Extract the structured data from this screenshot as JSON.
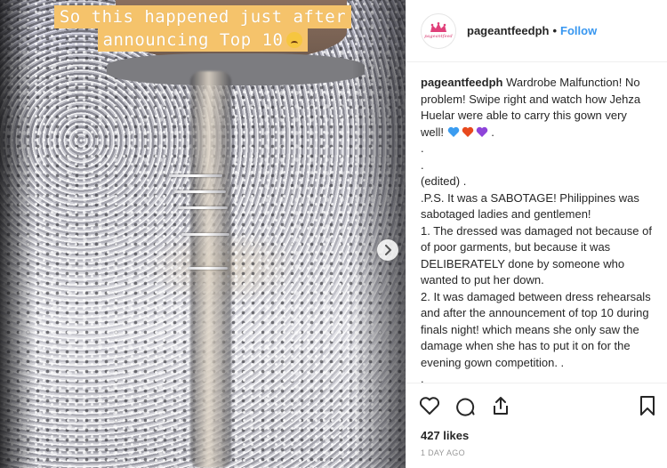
{
  "photo": {
    "overlay_lines": [
      "So this happened just after",
      "announcing Top 10"
    ]
  },
  "header": {
    "avatar_logo_text": "pageantfeed",
    "username": "pageantfeedph",
    "separator": "•",
    "follow_label": "Follow"
  },
  "caption": {
    "username": "pageantfeedph",
    "lines": [
      "Wardrobe Malfunction! No problem! Swipe right and watch how Jehza Huelar were able to carry this gown very well!",
      ".",
      ".",
      "(edited) .",
      ".P.S. It was a SABOTAGE! Philippines was sabotaged ladies and gentlemen!",
      "1. The dressed was damaged not because of of poor garments, but because it was DELIBERATELY done by someone who wanted to put her down.",
      "2. It was damaged between dress rehearsals and after the announcement of top 10 during finals night! which means she only saw the damage when she has to put it on for the evening gown competition. .",
      "."
    ],
    "heart_colors": [
      "#3b9cf0",
      "#e8491d",
      "#8e44d9"
    ],
    "after_hearts": " ."
  },
  "likes": {
    "text": "427 likes"
  },
  "timestamp": {
    "text": "1 DAY AGO"
  },
  "colors": {
    "follow": "#3897f0",
    "overlay_bg": "#f5c36b",
    "brand": "#d6336c"
  }
}
